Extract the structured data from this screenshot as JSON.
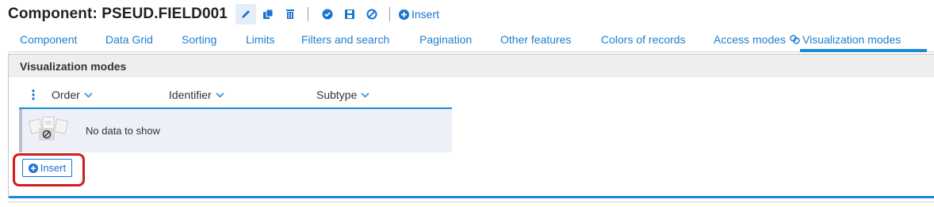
{
  "header": {
    "title": "Component: PSEUD.FIELD001",
    "insert_label": "Insert",
    "icons": [
      "edit-icon",
      "copy-icon",
      "delete-icon",
      "check-icon",
      "save-icon",
      "cancel-icon",
      "plus-circle-icon"
    ]
  },
  "tabs": [
    {
      "label": "Component"
    },
    {
      "label": "Data Grid"
    },
    {
      "label": "Sorting"
    },
    {
      "label": "Limits"
    },
    {
      "label": "Filters and search"
    },
    {
      "label": "Pagination"
    },
    {
      "label": "Other features"
    },
    {
      "label": "Colors of records"
    },
    {
      "label": "Access modes"
    },
    {
      "label": "Visualization modes",
      "active": true
    }
  ],
  "panel": {
    "title": "Visualization modes"
  },
  "grid": {
    "columns": [
      "Order",
      "Identifier",
      "Subtype"
    ],
    "empty_text": "No data to show"
  },
  "insert_button": {
    "label": "Insert"
  },
  "colors": {
    "accent": "#1a8ad4",
    "link": "#1f7fd0",
    "highlight": "#d01d1d"
  }
}
